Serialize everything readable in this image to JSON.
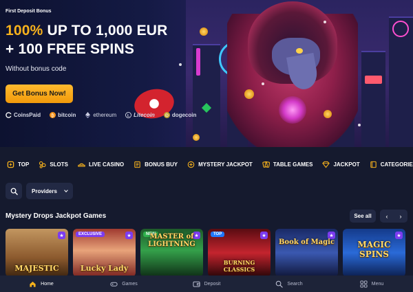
{
  "hero": {
    "label": "First Deposit Bonus",
    "line1_highlight": "100%",
    "line1_rest": " UP TO 1,000 EUR",
    "line2": "+ 100 FREE SPINS",
    "note": "Without bonus code",
    "cta": "Get Bonus Now!",
    "payments": [
      {
        "name": "CoinsPaid",
        "icon": "coinspaid-icon"
      },
      {
        "name": "bitcoin",
        "icon": "bitcoin-icon"
      },
      {
        "name": "ethereum",
        "icon": "ethereum-icon"
      },
      {
        "name": "Litecoin",
        "icon": "litecoin-icon"
      },
      {
        "name": "dogecoin",
        "icon": "dogecoin-icon"
      }
    ]
  },
  "categories": [
    {
      "label": "TOP",
      "icon": "top-icon"
    },
    {
      "label": "SLOTS",
      "icon": "slots-icon"
    },
    {
      "label": "LIVE CASINO",
      "icon": "live-casino-icon"
    },
    {
      "label": "BONUS BUY",
      "icon": "bonus-buy-icon"
    },
    {
      "label": "MYSTERY JACKPOT",
      "icon": "mystery-jackpot-icon"
    },
    {
      "label": "TABLE GAMES",
      "icon": "table-games-icon"
    },
    {
      "label": "JACKPOT",
      "icon": "jackpot-icon"
    },
    {
      "label": "CATEGORIES+",
      "icon": "categories-icon"
    }
  ],
  "filters": {
    "providers_label": "Providers"
  },
  "section": {
    "title": "Mystery Drops Jackpot Games",
    "see_all": "See all"
  },
  "games": [
    {
      "title": "MAJESTIC",
      "badge": ""
    },
    {
      "title": "Lucky Lady",
      "badge": "EXCLUSIVE"
    },
    {
      "title": "MASTER of LIGHTNING",
      "badge": "NEW"
    },
    {
      "title": "BURNING CLASSICS",
      "badge": "TOP"
    },
    {
      "title": "Book of Magic",
      "badge": ""
    },
    {
      "title": "MAGIC SPINS",
      "badge": ""
    }
  ],
  "bottom_nav": [
    {
      "label": "Home",
      "icon": "home-icon",
      "active": true
    },
    {
      "label": "Games",
      "icon": "games-icon",
      "active": false
    },
    {
      "label": "Deposit",
      "icon": "wallet-icon",
      "active": false
    },
    {
      "label": "Search",
      "icon": "search-icon",
      "active": false
    },
    {
      "label": "Menu",
      "icon": "menu-grid-icon",
      "active": false
    }
  ],
  "colors": {
    "accent": "#f7b21c",
    "background": "#151a2e",
    "panel": "#222944",
    "badge_purple": "#7c3cf0"
  }
}
